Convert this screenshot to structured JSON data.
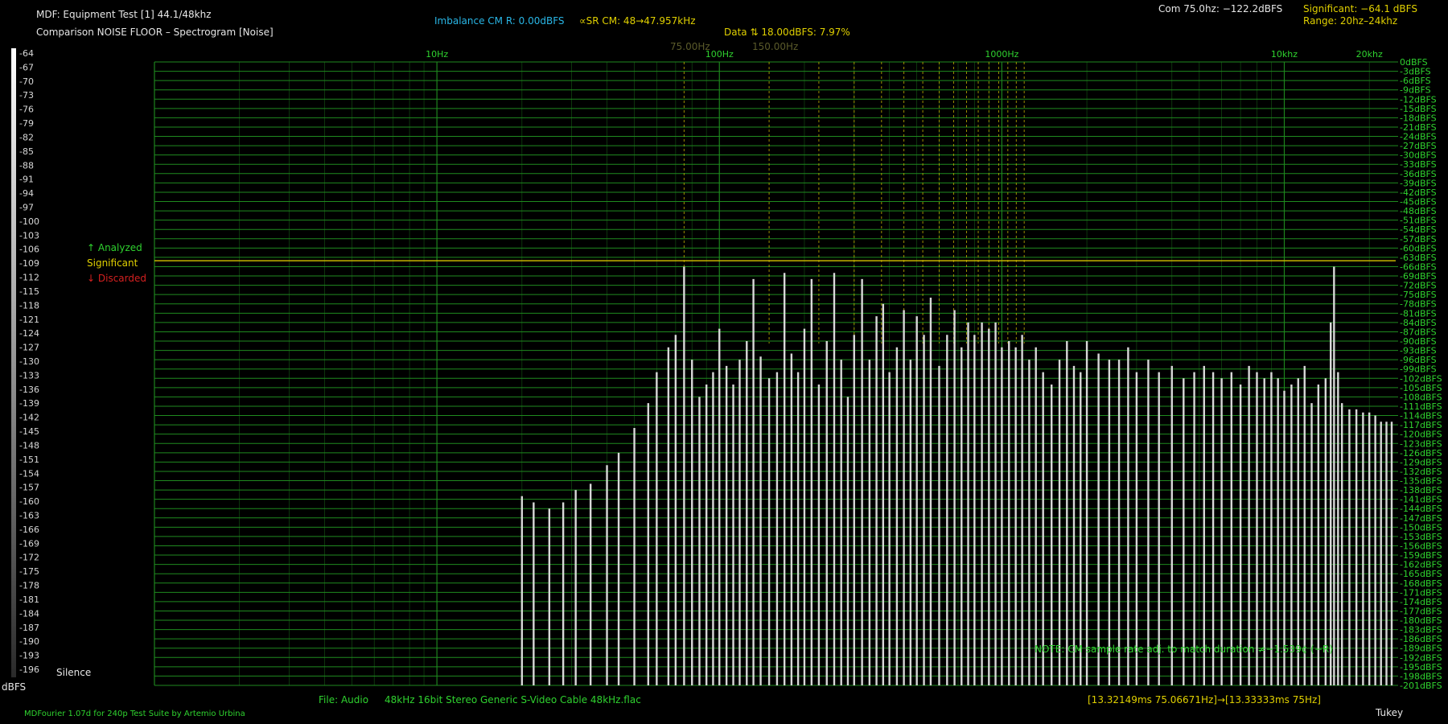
{
  "header": {
    "title": "MDF: Equipment Test [1] 44.1/48khz",
    "subtitle": "Comparison NOISE FLOOR – Spectrogram [Noise]",
    "imbalance": "Imbalance CM R: 0.00dBFS",
    "sr_cm": "∝SR CM: 48→47.957kHz",
    "data_line": "Data ⇅ 18.00dBFS: 7.97%",
    "com_line": "Com 75.0hz: −122.2dBFS",
    "significant_line": "Significant: −64.1 dBFS",
    "range_line": "Range: 20hz–24khz",
    "marker_75": "75.00Hz",
    "marker_150": "150.00Hz"
  },
  "legend": {
    "analyzed": "↑ Analyzed",
    "significant": "Significant",
    "discarded": "↓ Discarded"
  },
  "footer": {
    "file_label": "File: Audio",
    "file_name": "48kHz 16bit Stereo Generic S-Video Cable 48kHz.flac",
    "time_range": "[13.32149ms 75.06671Hz]→[13.33333ms 75Hz]",
    "credit": "MDFourier 1.07d for 240p Test Suite by Artemio Urbina",
    "window": "Tukey",
    "note": "NOTE: CM sample rate adj. to match duration ≠−1.539¢ (−R)"
  },
  "colorbar": {
    "unit": "dBFS",
    "silence": "Silence",
    "ticks": [
      "-64",
      "-67",
      "-70",
      "-73",
      "-76",
      "-79",
      "-82",
      "-85",
      "-88",
      "-91",
      "-94",
      "-97",
      "-100",
      "-103",
      "-106",
      "-109",
      "-112",
      "-115",
      "-118",
      "-121",
      "-124",
      "-127",
      "-130",
      "-133",
      "-136",
      "-139",
      "-142",
      "-145",
      "-148",
      "-151",
      "-154",
      "-157",
      "-160",
      "-163",
      "-166",
      "-169",
      "-172",
      "-175",
      "-178",
      "-181",
      "-184",
      "-187",
      "-190",
      "-193",
      "-196"
    ]
  },
  "colors": {
    "grid": "#1f8a1f",
    "grid_text": "#2fd22f",
    "significant": "#c8b400",
    "marker_lines": "#b8a800",
    "spectrum": "#d8d8d8"
  },
  "chart_data": {
    "type": "line",
    "x_scale": "log",
    "xlim": [
      1,
      24000
    ],
    "ylim": [
      -201,
      0
    ],
    "x_tick_labels": [
      {
        "hz": 10,
        "label": "10Hz"
      },
      {
        "hz": 100,
        "label": "100Hz"
      },
      {
        "hz": 1000,
        "label": "1000Hz"
      },
      {
        "hz": 10000,
        "label": "10khz"
      },
      {
        "hz": 20000,
        "label": "20khz"
      }
    ],
    "y_tick_labels": [
      "0dBFS",
      "-3dBFS",
      "-6dBFS",
      "-9dBFS",
      "-12dBFS",
      "-15dBFS",
      "-18dBFS",
      "-21dBFS",
      "-24dBFS",
      "-27dBFS",
      "-30dBFS",
      "-33dBFS",
      "-36dBFS",
      "-39dBFS",
      "-42dBFS",
      "-45dBFS",
      "-48dBFS",
      "-51dBFS",
      "-54dBFS",
      "-57dBFS",
      "-60dBFS",
      "-63dBFS",
      "-66dBFS",
      "-69dBFS",
      "-72dBFS",
      "-75dBFS",
      "-78dBFS",
      "-81dBFS",
      "-84dBFS",
      "-87dBFS",
      "-90dBFS",
      "-93dBFS",
      "-96dBFS",
      "-99dBFS",
      "-102dBFS",
      "-105dBFS",
      "-108dBFS",
      "-111dBFS",
      "-114dBFS",
      "-117dBFS",
      "-120dBFS",
      "-123dBFS",
      "-126dBFS",
      "-129dBFS",
      "-132dBFS",
      "-135dBFS",
      "-138dBFS",
      "-141dBFS",
      "-144dBFS",
      "-147dBFS",
      "-150dBFS",
      "-153dBFS",
      "-156dBFS",
      "-159dBFS",
      "-162dBFS",
      "-165dBFS",
      "-168dBFS",
      "-171dBFS",
      "-174dBFS",
      "-177dBFS",
      "-180dBFS",
      "-183dBFS",
      "-186dBFS",
      "-189dBFS",
      "-192dBFS",
      "-195dBFS",
      "-198dBFS",
      "-201dBFS"
    ],
    "significant_level": -64.1,
    "harmonic_markers_hz": [
      75,
      150
    ],
    "series": [
      {
        "x": [
          20,
          22,
          25,
          28,
          31,
          35,
          40,
          44,
          50,
          56,
          60,
          66,
          70,
          75,
          80,
          85,
          90,
          95,
          100,
          106,
          112,
          118,
          125,
          132,
          140,
          150,
          160,
          170,
          180,
          190,
          200,
          212,
          225,
          240,
          255,
          270,
          285,
          300,
          320,
          340,
          360,
          380,
          400,
          425,
          450,
          475,
          500,
          530,
          560,
          600,
          640,
          680,
          720,
          760,
          800,
          850,
          900,
          950,
          1000,
          1060,
          1120,
          1180,
          1250,
          1320,
          1400,
          1500,
          1600,
          1700,
          1800,
          1900,
          2000,
          2200,
          2400,
          2600,
          2800,
          3000,
          3300,
          3600,
          4000,
          4400,
          4800,
          5200,
          5600,
          6000,
          6500,
          7000,
          7500,
          8000,
          8500,
          9000,
          9500,
          10000,
          10600,
          11200,
          11800,
          12500,
          13200,
          14000,
          14600,
          15000,
          15500,
          16000,
          17000,
          18000,
          19000,
          20000,
          21000,
          22000,
          23000,
          24000
        ],
        "y": [
          -140,
          -142,
          -144,
          -142,
          -138,
          -136,
          -130,
          -126,
          -118,
          -110,
          -100,
          -92,
          -88,
          -66,
          -96,
          -108,
          -104,
          -100,
          -86,
          -98,
          -104,
          -96,
          -90,
          -70,
          -95,
          -102,
          -100,
          -68,
          -94,
          -100,
          -86,
          -70,
          -104,
          -90,
          -68,
          -96,
          -108,
          -88,
          -70,
          -96,
          -82,
          -78,
          -100,
          -92,
          -80,
          -96,
          -82,
          -88,
          -76,
          -98,
          -88,
          -80,
          -92,
          -84,
          -88,
          -84,
          -86,
          -84,
          -92,
          -90,
          -92,
          -88,
          -96,
          -92,
          -100,
          -104,
          -96,
          -90,
          -98,
          -100,
          -90,
          -94,
          -96,
          -96,
          -92,
          -100,
          -96,
          -100,
          -98,
          -102,
          -100,
          -98,
          -100,
          -102,
          -100,
          -104,
          -98,
          -100,
          -102,
          -100,
          -102,
          -106,
          -104,
          -102,
          -98,
          -110,
          -104,
          -102,
          -84,
          -66,
          -100,
          -110,
          -112,
          -112,
          -113,
          -113,
          -114,
          -116,
          -116,
          -116
        ]
      }
    ]
  }
}
